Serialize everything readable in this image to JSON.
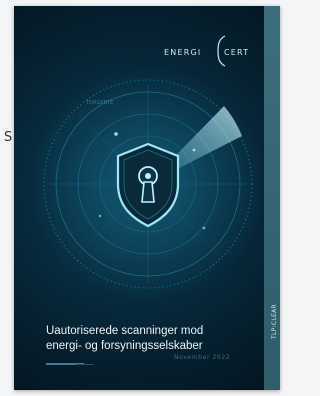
{
  "stray_mark": "S",
  "cover": {
    "logo": {
      "left": "ENERGI",
      "right": "CERT"
    },
    "radar_label": "TORGENTE",
    "title_line1": "Uautoriserede scanninger mod",
    "title_line2": "energi- og forsyningsselskaber",
    "date": "November 2022",
    "classification": "TLP:CLEAR"
  },
  "colors": {
    "background": "#04151f",
    "strip": "#3c6f7d",
    "radar": "#2aa6c8",
    "beam": "#8fe3f4"
  },
  "icons": [
    "shield-icon",
    "keyhole-icon",
    "radar-icon"
  ]
}
